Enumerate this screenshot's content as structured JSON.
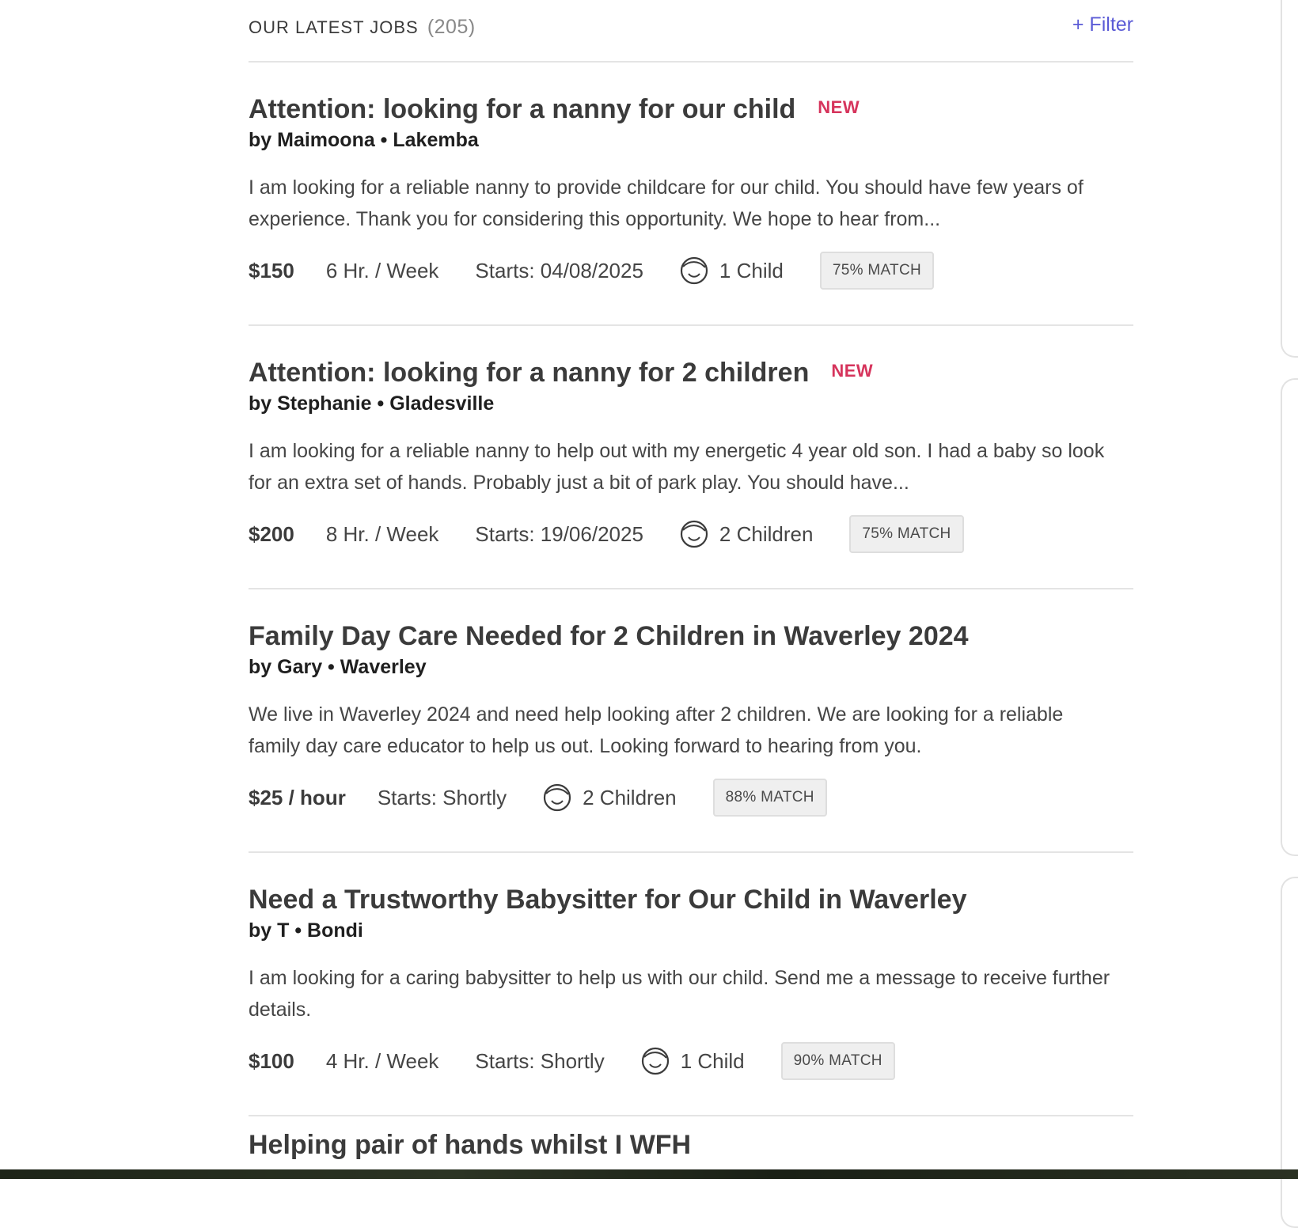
{
  "header": {
    "title": "OUR LATEST JOBS",
    "count": "(205)",
    "filter_label": "+ Filter"
  },
  "jobs": [
    {
      "title": "Attention: looking for a nanny for our child",
      "badge": "NEW",
      "byline": "by Maimoona • Lakemba",
      "description": "I am looking for a reliable nanny to provide childcare for our child. You should have few years of experience. Thank you for considering this opportunity. We hope to hear from...",
      "price": "$150",
      "hours": "6 Hr. / Week",
      "starts": "Starts: 04/08/2025",
      "children": "1 Child",
      "match": "75% MATCH"
    },
    {
      "title": "Attention: looking for a nanny for 2 children",
      "badge": "NEW",
      "byline": "by Stephanie • Gladesville",
      "description": "I am looking for a reliable nanny to help out with my energetic 4 year old son. I had a baby so look for an extra set of hands. Probably just a bit of park play. You should have...",
      "price": "$200",
      "hours": "8 Hr. / Week",
      "starts": "Starts: 19/06/2025",
      "children": "2 Children",
      "match": "75% MATCH"
    },
    {
      "title": "Family Day Care Needed for 2 Children in Waverley 2024",
      "badge": "",
      "byline": "by Gary • Waverley",
      "description": "We live in Waverley 2024 and need help looking after 2 children. We are looking for a reliable family day care educator to help us out. Looking forward to hearing from you.",
      "price": "$25 / hour",
      "hours": "",
      "starts": "Starts: Shortly",
      "children": "2 Children",
      "match": "88% MATCH"
    },
    {
      "title": "Need a Trustworthy Babysitter for Our Child in Waverley",
      "badge": "",
      "byline": "by T • Bondi",
      "description": "I am looking for a caring babysitter to help us with our child. Send me a message to receive further details.",
      "price": "$100",
      "hours": "4 Hr. / Week",
      "starts": "Starts: Shortly",
      "children": "1 Child",
      "match": "90% MATCH"
    }
  ],
  "next_job_title": "Helping pair of hands whilst I WFH",
  "icons": {
    "children": "child-face-icon"
  },
  "colors": {
    "accent_link": "#5b5bd6",
    "new_badge": "#d6345c",
    "text": "#3b3b3b"
  }
}
